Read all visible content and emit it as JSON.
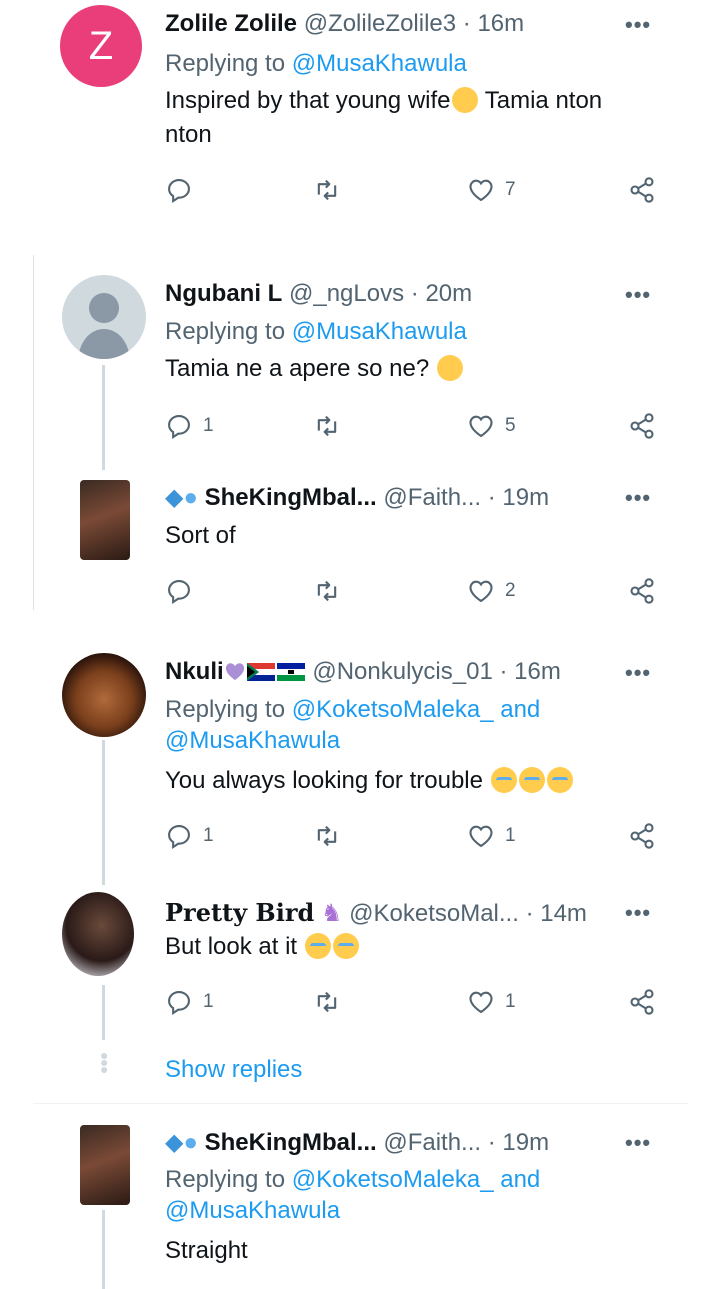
{
  "tweets": [
    {
      "avatar_letter": "Z",
      "name": "Zolile Zolile",
      "handle": "@ZolileZolile3",
      "time": "· 16m",
      "replying_label": "Replying to",
      "replying_to": "@MusaKhawula",
      "text_before": "Inspired by that young wife",
      "text_after": " Tamia nton",
      "text_line2": "nton",
      "replies": "",
      "likes": "7"
    },
    {
      "name": "Ngubani L",
      "handle": "@_ngLovs",
      "time": "· 20m",
      "replying_label": "Replying to",
      "replying_to": "@MusaKhawula",
      "text": "Tamia ne a apere so ne?",
      "replies": "1",
      "likes": "5"
    },
    {
      "name": "SheKingMbal...",
      "handle": "@Faith...",
      "time": "· 19m",
      "text": "Sort of",
      "replies": "",
      "likes": "2"
    },
    {
      "name": "Nkuli",
      "handle": "@Nonkulycis_01",
      "time": "· 16m",
      "replying_label": "Replying to",
      "replying_to": "@KoketsoMaleka_ and",
      "replying_to_2": "@MusaKhawula",
      "text": "You always looking for trouble",
      "replies": "1",
      "likes": "1"
    },
    {
      "name": "Pretty Bird",
      "handle": "@KoketsoMal...",
      "time": "· 14m",
      "text": "But look at it",
      "replies": "1",
      "likes": "1"
    },
    {
      "name": "SheKingMbal...",
      "handle": "@Faith...",
      "time": "· 19m",
      "replying_label": "Replying to",
      "replying_to": "@KoketsoMaleka_ and",
      "replying_to_2": "@MusaKhawula",
      "text": "Straight"
    }
  ],
  "show_replies": "Show replies",
  "more_glyph": "•••",
  "icons": [
    "reply-icon",
    "retweet-icon",
    "like-icon",
    "share-icon",
    "more-icon"
  ],
  "colors": {
    "link": "#1d9bf0",
    "muted": "#536471",
    "avatar_z": "#ea3e7a"
  }
}
